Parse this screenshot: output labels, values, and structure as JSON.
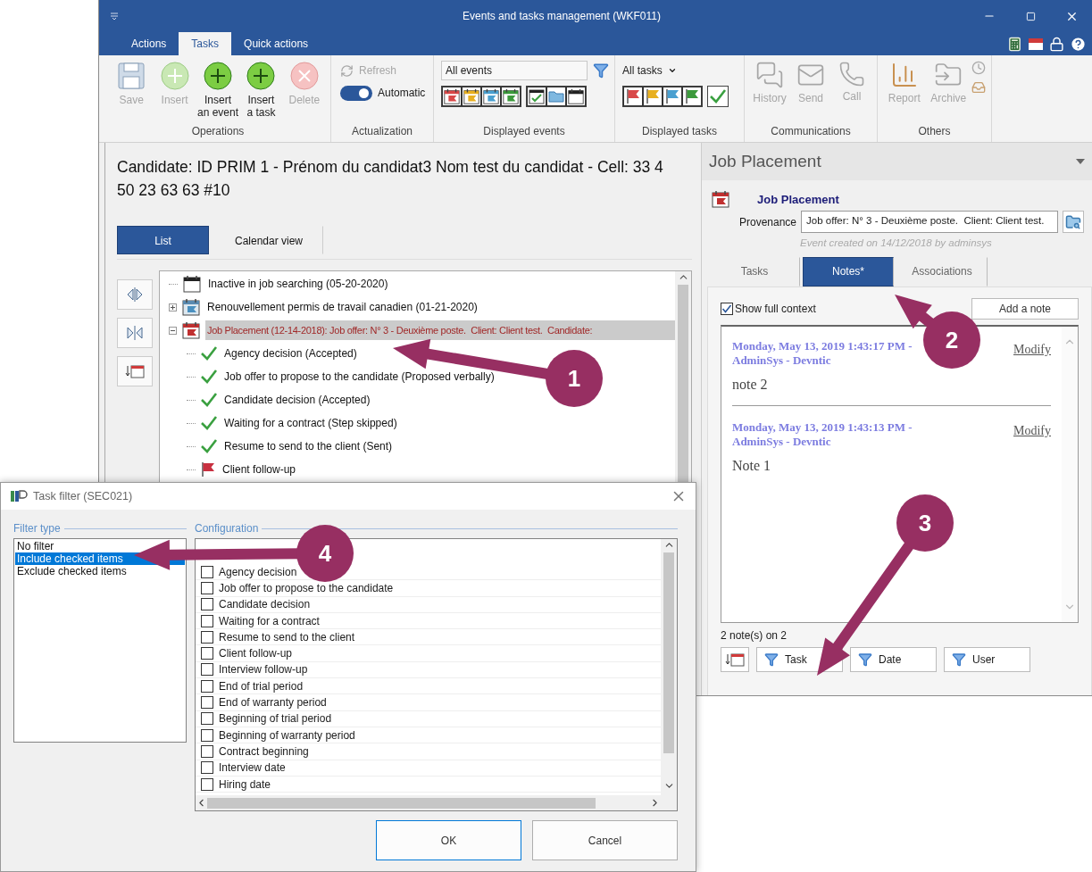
{
  "window": {
    "title": "Events and tasks management (WKF011)"
  },
  "ribbon_tabs": [
    {
      "label": "Actions",
      "selected": false
    },
    {
      "label": "Tasks",
      "selected": true
    },
    {
      "label": "Quick actions",
      "selected": false
    }
  ],
  "ribbon": {
    "operations": {
      "label": "Operations",
      "buttons": [
        {
          "label": "Save",
          "kind": "save",
          "disabled": true
        },
        {
          "label": "Insert",
          "kind": "add",
          "disabled": true
        },
        {
          "label": "Insert\nan event",
          "kind": "add",
          "disabled": false
        },
        {
          "label": "Insert\na task",
          "kind": "add",
          "disabled": false
        },
        {
          "label": "Delete",
          "kind": "delete",
          "disabled": true
        }
      ]
    },
    "actualization": {
      "label": "Actualization",
      "refresh": {
        "label": "Refresh",
        "disabled": true
      },
      "toggle": {
        "label": "Automatic",
        "on": true
      }
    },
    "displayed_events": {
      "label": "Displayed events",
      "field": {
        "value": "All events"
      },
      "toggles": [
        {
          "kind": "calendar-flag",
          "color": "#d94848"
        },
        {
          "kind": "calendar-flag",
          "color": "#e8b020"
        },
        {
          "kind": "calendar-flag",
          "color": "#4aa0d0"
        },
        {
          "kind": "calendar-flag",
          "color": "#3c9a3c"
        },
        {
          "kind": "calendar-check"
        },
        {
          "kind": "folder"
        },
        {
          "kind": "calendar"
        }
      ]
    },
    "displayed_tasks": {
      "label": "Displayed tasks",
      "dropdown": "All tasks",
      "toggles": [
        {
          "kind": "flag",
          "color": "#d94848"
        },
        {
          "kind": "flag",
          "color": "#e8b020"
        },
        {
          "kind": "flag",
          "color": "#4aa0d0"
        },
        {
          "kind": "flag",
          "color": "#3c9a3c"
        },
        {
          "kind": "check"
        }
      ]
    },
    "communications": {
      "label": "Communications",
      "buttons": [
        {
          "label": "History",
          "kind": "history",
          "disabled": true
        },
        {
          "label": "Send",
          "kind": "send",
          "disabled": true
        },
        {
          "label": "Call",
          "kind": "call",
          "disabled": true
        }
      ]
    },
    "others": {
      "label": "Others",
      "buttons": [
        {
          "label": "Report",
          "kind": "report",
          "disabled": true
        },
        {
          "label": "Archive",
          "kind": "archive",
          "disabled": true
        }
      ]
    }
  },
  "candidate_header": "Candidate: ID PRIM 1 - Prénom du candidat3 Nom test du candidat - Cell: 33 4 50 23 63 63 #10",
  "view_tabs": [
    {
      "label": "List",
      "selected": true
    },
    {
      "label": "Calendar view",
      "selected": false
    }
  ],
  "tree": [
    {
      "label": "Inactive in job searching (05-20-2020)",
      "kind": "calendar",
      "selected": false
    },
    {
      "label": "Renouvellement permis de travail canadien (01-21-2020)",
      "kind": "calendar-event",
      "selected": false,
      "expanded": false
    },
    {
      "label": "Job Placement (12-14-2018): Job offer: N° 3 - Deuxième poste.  Client: Client test.  Candidate:",
      "kind": "calendar-placement",
      "selected": true,
      "expanded": true,
      "children": [
        {
          "label": "Agency decision (Accepted)",
          "kind": "check"
        },
        {
          "label": "Job offer to propose to the candidate (Proposed verbally)",
          "kind": "check"
        },
        {
          "label": "Candidate decision (Accepted)",
          "kind": "check"
        },
        {
          "label": "Waiting for a contract (Step skipped)",
          "kind": "check"
        },
        {
          "label": "Resume to send to the client (Sent)",
          "kind": "check"
        },
        {
          "label": "Client follow-up",
          "kind": "flag"
        }
      ]
    }
  ],
  "right_panel": {
    "title": "Job Placement",
    "event_title": "Job Placement",
    "provenance": {
      "label": "Provenance",
      "value": "Job offer: N° 3 - Deuxième poste.  Client: Client test."
    },
    "created": "Event created on 14/12/2018 by adminsys",
    "tabs": [
      {
        "label": "Tasks",
        "selected": false
      },
      {
        "label": "Notes*",
        "selected": true
      },
      {
        "label": "Associations",
        "selected": false
      }
    ],
    "show_full_context": {
      "label": "Show full context",
      "checked": true
    },
    "add_note": "Add a note",
    "notes": [
      {
        "header": "Monday, May 13, 2019 1:43:17 PM - AdminSys - Devntic",
        "link": "Modify",
        "body": "note 2"
      },
      {
        "header": "Monday, May 13, 2019 1:43:13 PM - AdminSys - Devntic",
        "link": "Modify",
        "body": "Note 1"
      }
    ],
    "count": "2 note(s) on 2",
    "filter_buttons": [
      "Task",
      "Date",
      "User"
    ]
  },
  "dialog": {
    "title": "Task filter (SEC021)",
    "filter_type": {
      "legend": "Filter type",
      "items": [
        {
          "label": "No filter",
          "selected": false
        },
        {
          "label": "Include checked items",
          "selected": true
        },
        {
          "label": "Exclude checked items",
          "selected": false
        }
      ]
    },
    "configuration": {
      "legend": "Configuration",
      "items": [
        {
          "label": "Agency decision",
          "checked": false
        },
        {
          "label": "Job offer to propose to the candidate",
          "checked": false
        },
        {
          "label": "Candidate decision",
          "checked": false
        },
        {
          "label": "Waiting for a contract",
          "checked": false
        },
        {
          "label": "Resume to send to the client",
          "checked": false
        },
        {
          "label": "Client follow-up",
          "checked": false
        },
        {
          "label": "Interview follow-up",
          "checked": false
        },
        {
          "label": "End of trial period",
          "checked": false
        },
        {
          "label": "End of warranty period",
          "checked": false
        },
        {
          "label": "Beginning of trial period",
          "checked": false
        },
        {
          "label": "Beginning of warranty period",
          "checked": false
        },
        {
          "label": "Contract beginning",
          "checked": false
        },
        {
          "label": "Interview date",
          "checked": false
        },
        {
          "label": "Hiring date",
          "checked": false
        }
      ]
    },
    "buttons": [
      {
        "label": "OK",
        "default": true
      },
      {
        "label": "Cancel",
        "default": false
      }
    ]
  },
  "callouts": [
    {
      "number": "1"
    },
    {
      "number": "2"
    },
    {
      "number": "3"
    },
    {
      "number": "4"
    }
  ]
}
